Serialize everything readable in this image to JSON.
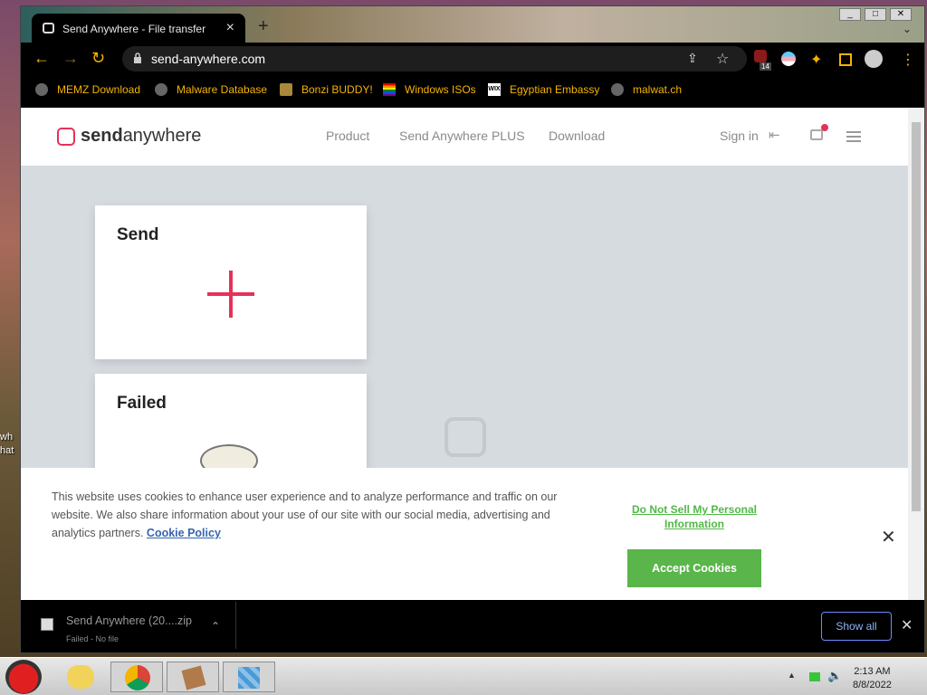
{
  "desktop": {
    "left_text": "wh hat"
  },
  "browser": {
    "tab_title": "Send Anywhere - File transfer",
    "url": "send-anywhere.com",
    "extension_badge": "14",
    "bookmarks": [
      {
        "label": "MEMZ Download"
      },
      {
        "label": "Malware Database"
      },
      {
        "label": "Bonzi BUDDY!"
      },
      {
        "label": "Windows ISOs"
      },
      {
        "label": "Egyptian Embassy"
      },
      {
        "label": "malwat.ch"
      }
    ]
  },
  "site": {
    "logo_send": "send",
    "logo_anywhere": "anywhere",
    "nav": [
      "Product",
      "Send Anywhere PLUS",
      "Download"
    ],
    "sign_in": "Sign in",
    "send_card_title": "Send",
    "failed_card_title": "Failed",
    "accent_color": "#e5315a"
  },
  "cookie": {
    "text": "This website uses cookies to enhance user experience and to analyze performance and traffic on our website. We also share information about your use of our site with our social media, advertising and analytics partners.",
    "policy_link": "Cookie Policy",
    "do_not_sell": "Do Not Sell My Personal Information",
    "accept": "Accept Cookies",
    "close": "✕"
  },
  "download": {
    "filename": "Send Anywhere (20....zip",
    "status": "Failed - No file",
    "show_all": "Show all"
  },
  "taskbar": {
    "time": "2:13 AM",
    "date": "8/8/2022"
  }
}
